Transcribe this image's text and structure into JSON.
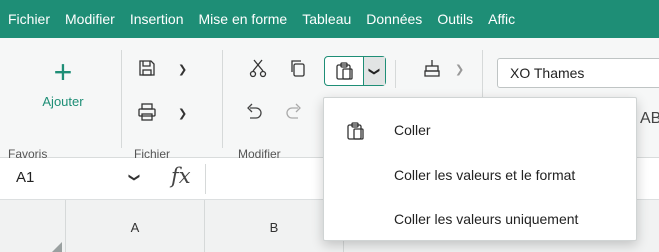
{
  "menubar": {
    "items": [
      "Fichier",
      "Modifier",
      "Insertion",
      "Mise en forme",
      "Tableau",
      "Données",
      "Outils",
      "Affic"
    ],
    "color": "#1e8e76"
  },
  "ribbon": {
    "favoris": {
      "add_label": "Ajouter",
      "group_label": "Favoris"
    },
    "fichier": {
      "group_label": "Fichier"
    },
    "modifier": {
      "group_label": "Modifier"
    },
    "font": {
      "value": "XO Thames"
    },
    "overflow_text": "AB"
  },
  "formula_bar": {
    "cell_ref": "A1",
    "fx": "fx"
  },
  "columns": [
    "A",
    "B"
  ],
  "paste_menu": {
    "items": [
      {
        "label": "Coller",
        "icon": "clipboard-icon"
      },
      {
        "label": "Coller les valeurs et le format",
        "icon": ""
      },
      {
        "label": "Coller les valeurs uniquement",
        "icon": ""
      }
    ]
  },
  "colors": {
    "accent": "#1e8e76",
    "ribbon_bg": "#f6f7f7",
    "header_bg": "#f1f2f2"
  }
}
